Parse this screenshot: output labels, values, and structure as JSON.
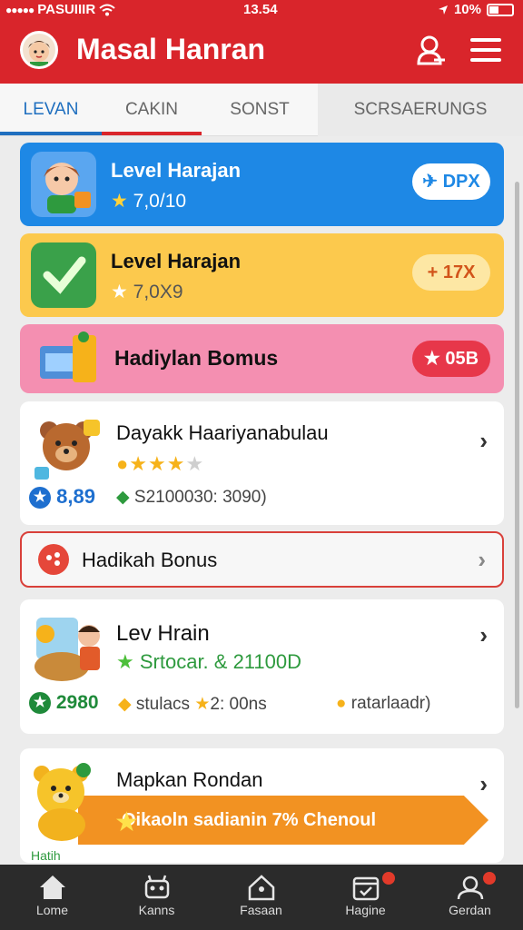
{
  "status_bar": {
    "carrier": "PASUIIIR",
    "time": "13.54",
    "battery": "10%"
  },
  "header": {
    "title": "Masal Hanran"
  },
  "tabs": [
    {
      "label": "LEVAN",
      "active": true
    },
    {
      "label": "CAKIN"
    },
    {
      "label": "SONST"
    },
    {
      "label": "SCRSAERUNGS"
    }
  ],
  "cards": [
    {
      "title": "Level Harajan",
      "subtitle": "7,0/10",
      "badge": "DPX",
      "color": "#1e88e5"
    },
    {
      "title": "Level Harajan",
      "subtitle": "7,0X9",
      "badge": "17X",
      "color": "#fcc94d"
    },
    {
      "title": "Hadiylan Bomus",
      "badge": "05B",
      "color": "#f48fb1"
    },
    {
      "title": "Dayakk Haariyanabulau",
      "rating": 3,
      "rating_max": 4,
      "points": "8,89",
      "detail": "S2100030: 3090)"
    },
    {
      "title": "Hadikah Bonus"
    },
    {
      "title": "Lev Hrain",
      "highlight": "Srtocar. & 21100D",
      "points": "2980",
      "detail1": "stulacs",
      "detail2": "2: 00ns",
      "detail3": "ratarlaadr)"
    },
    {
      "title": "Mapkan Rondan",
      "banner": "Oikaoln sadianin 7% Chenoul",
      "footer": "Hatih"
    }
  ],
  "nav": [
    {
      "label": "Lome"
    },
    {
      "label": "Kanns"
    },
    {
      "label": "Fasaan"
    },
    {
      "label": "Hagine",
      "has_badge": true
    },
    {
      "label": "Gerdan",
      "has_badge": true
    }
  ],
  "colors": {
    "brand": "#d9252b",
    "blue": "#1e88e5",
    "yellow": "#fcc94d",
    "pink": "#f48fb1",
    "green": "#2e9a3e",
    "orange": "#f29222"
  }
}
